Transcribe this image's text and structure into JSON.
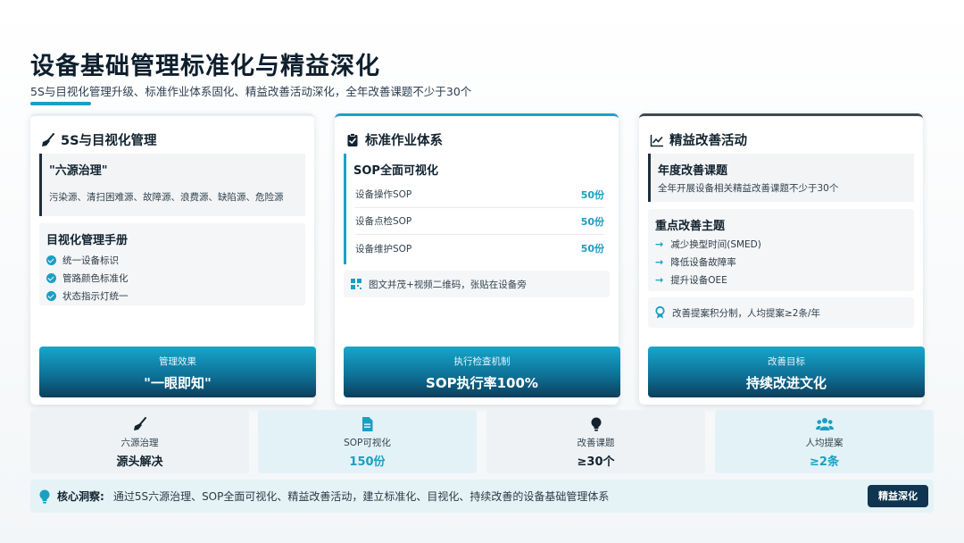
{
  "header": {
    "title": "设备基础管理标准化与精益深化",
    "subtitle": "5S与目视化管理升级、标准作业体系固化、精益改善活动深化，全年改善课题不少于30个"
  },
  "card1": {
    "heading": "5S与目视化管理",
    "quote_title": "\"六源治理\"",
    "quote_desc": "污染源、清扫困难源、故障源、浪费源、缺陷源、危险源",
    "manual_title": "目视化管理手册",
    "manual_items": [
      "统一设备标识",
      "管路颜色标准化",
      "状态指示灯统一"
    ],
    "button_label": "管理效果",
    "button_value": "\"一眼即知\""
  },
  "card2": {
    "heading": "标准作业体系",
    "quote_title": "SOP全面可视化",
    "sop_rows": [
      {
        "name": "设备操作SOP",
        "value": "50份"
      },
      {
        "name": "设备点检SOP",
        "value": "50份"
      },
      {
        "name": "设备维护SOP",
        "value": "50份"
      }
    ],
    "qr_note": "图文并茂+视频二维码，张贴在设备旁",
    "button_label": "执行检查机制",
    "button_value": "SOP执行率100%"
  },
  "card3": {
    "heading": "精益改善活动",
    "quote_title": "年度改善课题",
    "quote_desc": "全年开展设备相关精益改善课题不少于30个",
    "theme_title": "重点改善主题",
    "themes": [
      "减少换型时间(SMED)",
      "降低设备故障率",
      "提升设备OEE"
    ],
    "reward_note": "改善提案积分制，人均提案≥2条/年",
    "button_label": "改善目标",
    "button_value": "持续改进文化"
  },
  "stats": [
    {
      "label": "六源治理",
      "value": "源头解决",
      "icon": "broom-icon"
    },
    {
      "label": "SOP可视化",
      "value": "150份",
      "icon": "document-icon"
    },
    {
      "label": "改善课题",
      "value": "≥30个",
      "icon": "lightbulb-icon"
    },
    {
      "label": "人均提案",
      "value": "≥2条",
      "icon": "users-icon"
    }
  ],
  "insight": {
    "label": "核心洞察:",
    "text": "通过5S六源治理、SOP全面可视化、精益改善活动，建立标准化、目视化、持续改善的设备基础管理体系",
    "badge": "精益深化"
  },
  "colors": {
    "accent": "#1a9fc4",
    "dark": "#0f3550"
  }
}
